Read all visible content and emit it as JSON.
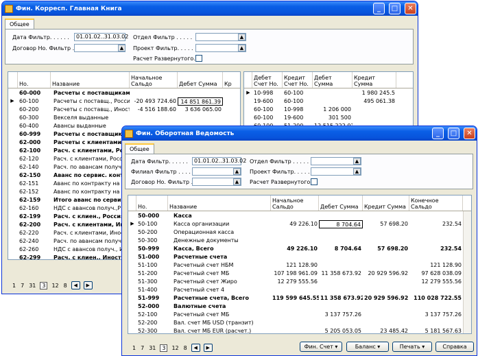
{
  "win1": {
    "title": "Фин. Корресп. Главная Книга",
    "tab": "Общее",
    "f": {
      "date_label": "Дата Фильтр. . . . . .",
      "date_value": "01.01.02..31.03.02",
      "contract_label": "Договор Но. Фильтр . .",
      "dept_label": "Отдел Фильтр . . . . .",
      "proj_label": "Проект Фильтр. . . . .",
      "expand_label": "Расчет Развернутого..."
    },
    "cols": [
      "Но.",
      "Название",
      "Начальное Сальдо",
      "Дебет Сумма",
      "Кр"
    ],
    "rows": [
      {
        "no": "60-000",
        "name": "Расчеты с поставщиками",
        "b": true
      },
      {
        "no": "60-100",
        "name": "Расчеты с поставщ., Россия",
        "bal": "-20 493 724.60",
        "deb": "14 851 861.39",
        "cur": true
      },
      {
        "no": "60-200",
        "name": "Расчеты с поставщ., Иностр.",
        "bal": "-4 516 188.60",
        "deb": "3 636 065.00"
      },
      {
        "no": "60-300",
        "name": "Векселя выданные"
      },
      {
        "no": "60-400",
        "name": "Авансы выданные"
      },
      {
        "no": "60-999",
        "name": "Расчеты с поставщиками",
        "b": true
      },
      {
        "no": "62-000",
        "name": "Расчеты с клиентами",
        "b": true
      },
      {
        "no": "62-100",
        "name": "Расч. с клиентами, Россия",
        "b": true
      },
      {
        "no": "62-120",
        "name": "Расч. с клиентами, Росси"
      },
      {
        "no": "62-140",
        "name": "Расч. по авансам получ.,"
      },
      {
        "no": "62-150",
        "name": "Аванс по сервис. конт",
        "b": true
      },
      {
        "no": "62-151",
        "name": "Аванс по контракту на"
      },
      {
        "no": "62-152",
        "name": "Аванс по контракту на"
      },
      {
        "no": "62-159",
        "name": "Итого аванс по сервис",
        "b": true
      },
      {
        "no": "62-160",
        "name": "НДС с авансов получ.,Р"
      },
      {
        "no": "62-199",
        "name": "Расч. с клиен., Россия, Вс",
        "b": true
      },
      {
        "no": "62-200",
        "name": "Расч. с клиентами, Иност",
        "b": true
      },
      {
        "no": "62-220",
        "name": "Расч. с клиентами, Иност"
      },
      {
        "no": "62-240",
        "name": "Расч. по авансам получ.,"
      },
      {
        "no": "62-260",
        "name": "НДС с авансов получ., И."
      },
      {
        "no": "62-299",
        "name": "Расч. с клиен., Иностр.,",
        "b": true
      }
    ],
    "rcols": [
      "Дебет Счет Но.",
      "Кредит Счет Но.",
      "Дебет Сумма",
      "Кредит Сумма"
    ],
    "rrows": [
      {
        "d": "10-998",
        "k": "60-100",
        "ds": "",
        "ks": "1 980 245.5",
        "cur": true
      },
      {
        "d": "19-600",
        "k": "60-100",
        "ds": "",
        "ks": "495 061.38"
      },
      {
        "d": "60-100",
        "k": "10-998",
        "ds": "1 206 000",
        "ks": ""
      },
      {
        "d": "60-100",
        "k": "19-600",
        "ds": "301 500",
        "ks": ""
      },
      {
        "d": "60-100",
        "k": "51-200",
        "ds": "12 515 222.01",
        "ks": ""
      }
    ],
    "pages": [
      "1",
      "7",
      "31",
      "3",
      "12",
      "8"
    ]
  },
  "win2": {
    "title": "Фин. Оборотная Ведомость",
    "tab": "Общее",
    "f": {
      "date_label": "Дата Фильтр. . . . . .",
      "date_value": "01.01.02..31.03.02",
      "branch_label": "Филиал Фильтр . . . .",
      "contract_label": "Договор Но. Фильтр . .",
      "dept_label": "Отдел Фильтр . . . . .",
      "proj_label": "Проект Фильтр. . . . .",
      "expand_label": "Расчет Развернутого..."
    },
    "cols": [
      "Но.",
      "Название",
      "Начальное Сальдо",
      "Дебет Сумма",
      "Кредит Сумма",
      "Конечное Сальдо"
    ],
    "rows": [
      {
        "no": "50-000",
        "name": "Касса",
        "b": true
      },
      {
        "no": "50-100",
        "name": "Касса организации",
        "bal": "49 226.10",
        "deb": "8 704.64",
        "cr": "57 698.20",
        "end": "232.54",
        "cur": true
      },
      {
        "no": "50-200",
        "name": "Операционная касса"
      },
      {
        "no": "50-300",
        "name": "Денежные документы"
      },
      {
        "no": "50-999",
        "name": "Касса, Всего",
        "bal": "49 226.10",
        "deb": "8 704.64",
        "cr": "57 698.20",
        "end": "232.54",
        "b": true
      },
      {
        "no": "51-000",
        "name": "Расчетные счета",
        "b": true
      },
      {
        "no": "51-100",
        "name": "Расчетный счет НБМ",
        "bal": "121 128.90",
        "end": "121 128.90"
      },
      {
        "no": "51-200",
        "name": "Расчетный счет МБ",
        "bal": "107 198 961.09",
        "deb": "11 358 673.92",
        "cr": "20 929 596.92",
        "end": "97 628 038.09"
      },
      {
        "no": "51-300",
        "name": "Расчетный счет Жиро",
        "bal": "12 279 555.56",
        "end": "12 279 555.56"
      },
      {
        "no": "51-400",
        "name": "Расчетный счет 4"
      },
      {
        "no": "51-999",
        "name": "Расчетные счета, Всего",
        "bal": "119 599 645.55",
        "deb": "11 358 673.92",
        "cr": "20 929 596.92",
        "end": "110 028 722.55",
        "b": true
      },
      {
        "no": "52-000",
        "name": "Валютные счета",
        "b": true
      },
      {
        "no": "52-100",
        "name": "Расчетный счет МБ",
        "deb": "3 137 757.26",
        "end": "3 137 757.26"
      },
      {
        "no": "52-200",
        "name": "Вал. счет МБ USD (транзит)"
      },
      {
        "no": "52-300",
        "name": "Вал. счет МБ EUR (расчет.)",
        "deb": "5 205 053.05",
        "cr": "23 485.42",
        "end": "5 181 567.63"
      }
    ],
    "pages": [
      "1",
      "7",
      "31",
      "3",
      "12",
      "8"
    ],
    "buttons": {
      "fin": "Фин. Счет",
      "bal": "Баланс",
      "print": "Печать",
      "help": "Справка"
    }
  }
}
